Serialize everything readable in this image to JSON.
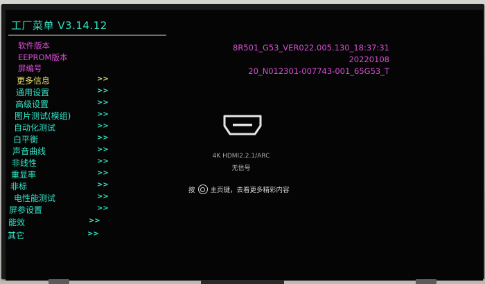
{
  "menu": {
    "title": "工厂菜单 V3.14.12",
    "info": [
      {
        "label": "软件版本",
        "value": "8R501_G53_VER022.005.130_18:37:31"
      },
      {
        "label": "EEPROM版本",
        "value": "20220108"
      },
      {
        "label": "屏编号",
        "value": "20_N012301-007743-001_65G53_T"
      }
    ],
    "items": [
      {
        "label": "更多信息",
        "arrow": ">>",
        "selected": true
      },
      {
        "label": "通用设置",
        "arrow": ">>"
      },
      {
        "label": "高级设置",
        "arrow": ">>"
      },
      {
        "label": "图片测试(模组)",
        "arrow": ">>"
      },
      {
        "label": "自动化测试",
        "arrow": ">>"
      },
      {
        "label": "白平衡",
        "arrow": ">>"
      },
      {
        "label": "声音曲线",
        "arrow": ">>"
      },
      {
        "label": "非线性",
        "arrow": ">>"
      },
      {
        "label": "重显率",
        "arrow": ">>"
      },
      {
        "label": "非标",
        "arrow": ">>"
      },
      {
        "label": "电性能测试",
        "arrow": ">>"
      },
      {
        "label": "屏参设置",
        "arrow": ">>"
      },
      {
        "label": "能效",
        "arrow": ">>"
      },
      {
        "label": "其它",
        "arrow": ">>"
      }
    ]
  },
  "source": {
    "icon": "hdmi-icon",
    "name": "4K HDMI2.2.1/ARC",
    "status": "无信号",
    "hint_prefix": "按",
    "hint_icon": "home-icon",
    "hint_suffix": "主页键，去看更多精彩内容"
  },
  "colors": {
    "menu_text": "#33e6c8",
    "selected_text": "#e9e36b",
    "info_text": "#d94ed6",
    "screen_bg": "#050505"
  }
}
